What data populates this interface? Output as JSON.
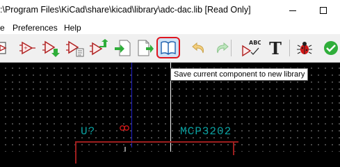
{
  "window": {
    "title": ":\\Program Files\\KiCad\\share\\kicad\\library\\adc-dac.lib [Read Only]"
  },
  "menu": {
    "items": [
      "e",
      "Preferences",
      "Help"
    ]
  },
  "toolbar": {
    "buttons": [
      {
        "icon": "component-icon-partial"
      },
      {
        "icon": "new-component-icon"
      },
      {
        "icon": "load-component-icon"
      },
      {
        "icon": "component-properties-icon"
      },
      {
        "icon": "import-component-icon"
      },
      {
        "icon": "export-component-icon"
      },
      {
        "icon": "save-as-library-icon"
      },
      {
        "icon": "undo-icon"
      },
      {
        "icon": "redo-icon"
      },
      {
        "icon": "spell-check-icon"
      },
      {
        "icon": "text-icon"
      },
      {
        "icon": "bug-icon"
      },
      {
        "icon": "check-icon"
      }
    ],
    "spell_label": "ABC",
    "text_glyph": "T"
  },
  "tooltip": {
    "text": "Save current component to new library"
  },
  "schematic": {
    "reference": "U?",
    "value": "MCP3202",
    "colors": {
      "field_text": "#0aa1a1",
      "body_outline": "#9e1e1e",
      "axis": "#1c1cc8"
    }
  }
}
